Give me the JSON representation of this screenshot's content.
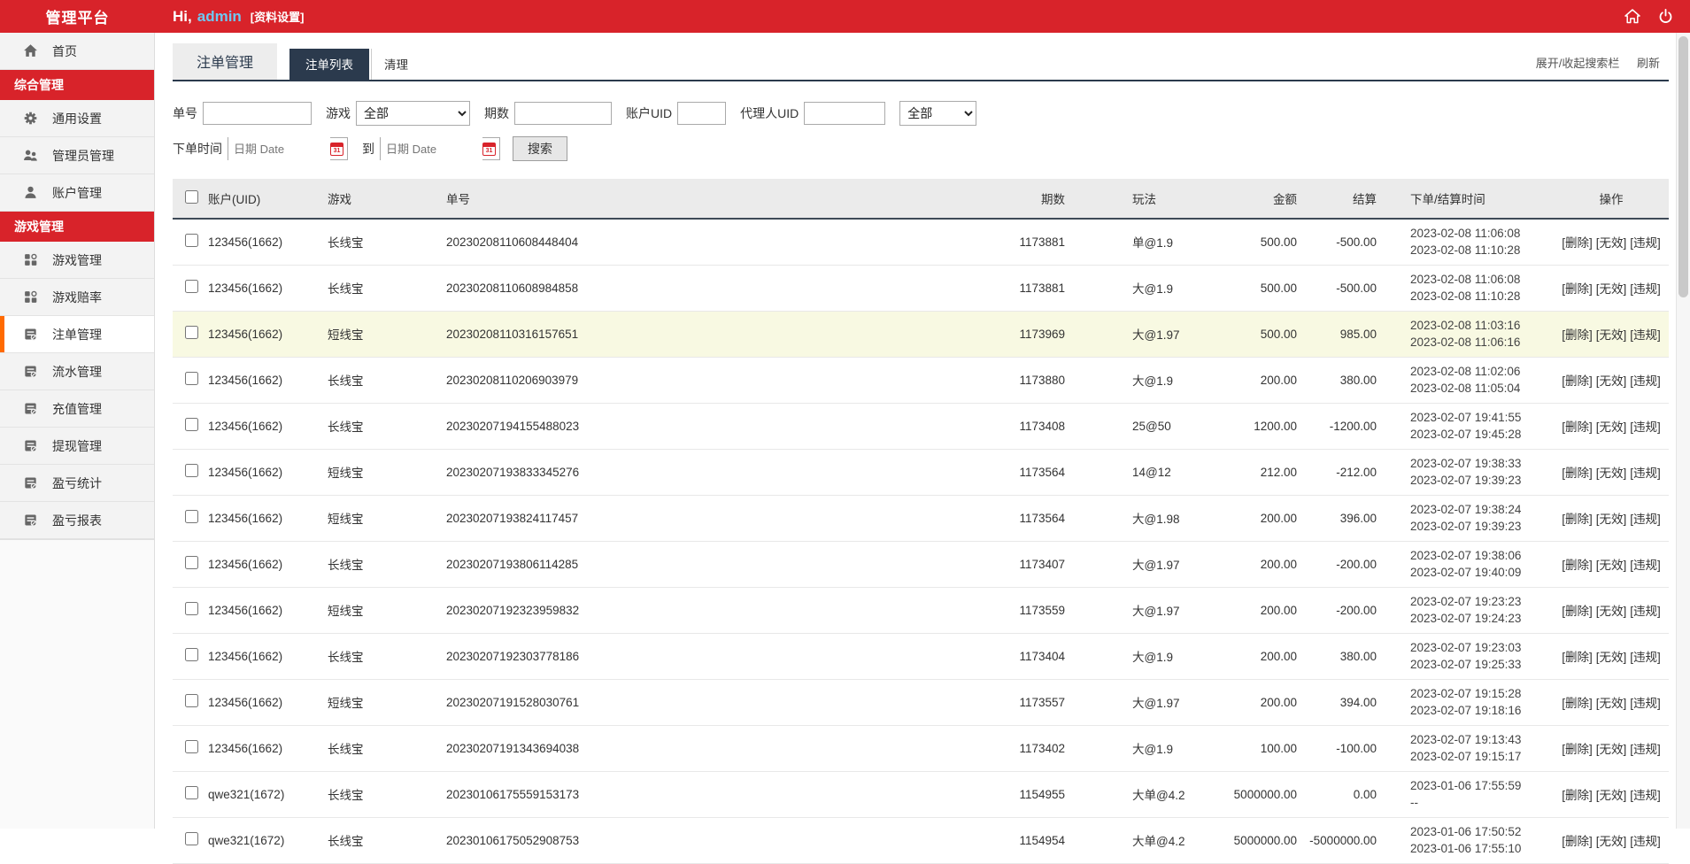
{
  "topbar": {
    "brand": "管理平台",
    "greeting_prefix": "Hi,",
    "username": "admin",
    "profile_link": "[资料设置]",
    "colors": {
      "bar": "#d8232a",
      "username": "#6fc7f2"
    }
  },
  "sidebar": {
    "items": [
      {
        "type": "item",
        "icon": "home",
        "label": "首页"
      },
      {
        "type": "section",
        "label": "综合管理"
      },
      {
        "type": "item",
        "icon": "gear",
        "label": "通用设置"
      },
      {
        "type": "item",
        "icon": "users",
        "label": "管理员管理"
      },
      {
        "type": "item",
        "icon": "user",
        "label": "账户管理"
      },
      {
        "type": "section",
        "label": "游戏管理"
      },
      {
        "type": "item",
        "icon": "grid",
        "label": "游戏管理"
      },
      {
        "type": "item",
        "icon": "grid",
        "label": "游戏赔率"
      },
      {
        "type": "item",
        "icon": "doc",
        "label": "注单管理",
        "active": true
      },
      {
        "type": "item",
        "icon": "doc",
        "label": "流水管理"
      },
      {
        "type": "item",
        "icon": "doc",
        "label": "充值管理"
      },
      {
        "type": "item",
        "icon": "doc",
        "label": "提现管理"
      },
      {
        "type": "item",
        "icon": "doc",
        "label": "盈亏统计"
      },
      {
        "type": "item",
        "icon": "doc",
        "label": "盈亏报表"
      }
    ],
    "active_accent": "#ff6a00"
  },
  "page": {
    "title": "注单管理",
    "tabs": [
      {
        "label": "注单列表",
        "active": true
      },
      {
        "label": "清理",
        "active": false
      }
    ],
    "toolbar": {
      "expand_label": "展开/收起搜索栏",
      "refresh_label": "刷新"
    },
    "accent_navy": "#2b3a4d"
  },
  "search": {
    "order_label": "单号",
    "game_label": "游戏",
    "game_value": "全部",
    "period_label": "期数",
    "account_uid_label": "账户UID",
    "agent_uid_label": "代理人UID",
    "status_value": "全部",
    "time_label": "下单时间",
    "to_label": "到",
    "date_placeholder": "日期 Date",
    "submit_label": "搜索"
  },
  "table": {
    "headers": [
      "账户(UID)",
      "游戏",
      "单号",
      "期数",
      "玩法",
      "金额",
      "结算",
      "下单/结算时间",
      "操作"
    ],
    "actions": [
      "[删除]",
      "[无效]",
      "[违规]"
    ],
    "highlight_color": "#f8f9e2",
    "rows": [
      {
        "account": "123456(1662)",
        "game": "长线宝",
        "order": "20230208110608448404",
        "period": "1173881",
        "play": "单@1.9",
        "amount": "500.00",
        "settle": "-500.00",
        "time1": "2023-02-08 11:06:08",
        "time2": "2023-02-08 11:10:28",
        "highlight": false
      },
      {
        "account": "123456(1662)",
        "game": "长线宝",
        "order": "20230208110608984858",
        "period": "1173881",
        "play": "大@1.9",
        "amount": "500.00",
        "settle": "-500.00",
        "time1": "2023-02-08 11:06:08",
        "time2": "2023-02-08 11:10:28",
        "highlight": false
      },
      {
        "account": "123456(1662)",
        "game": "短线宝",
        "order": "20230208110316157651",
        "period": "1173969",
        "play": "大@1.97",
        "amount": "500.00",
        "settle": "985.00",
        "time1": "2023-02-08 11:03:16",
        "time2": "2023-02-08 11:06:16",
        "highlight": true
      },
      {
        "account": "123456(1662)",
        "game": "长线宝",
        "order": "20230208110206903979",
        "period": "1173880",
        "play": "大@1.9",
        "amount": "200.00",
        "settle": "380.00",
        "time1": "2023-02-08 11:02:06",
        "time2": "2023-02-08 11:05:04",
        "highlight": false
      },
      {
        "account": "123456(1662)",
        "game": "长线宝",
        "order": "20230207194155488023",
        "period": "1173408",
        "play": "25@50",
        "amount": "1200.00",
        "settle": "-1200.00",
        "time1": "2023-02-07 19:41:55",
        "time2": "2023-02-07 19:45:28",
        "highlight": false
      },
      {
        "account": "123456(1662)",
        "game": "短线宝",
        "order": "20230207193833345276",
        "period": "1173564",
        "play": "14@12",
        "amount": "212.00",
        "settle": "-212.00",
        "time1": "2023-02-07 19:38:33",
        "time2": "2023-02-07 19:39:23",
        "highlight": false
      },
      {
        "account": "123456(1662)",
        "game": "短线宝",
        "order": "20230207193824117457",
        "period": "1173564",
        "play": "大@1.98",
        "amount": "200.00",
        "settle": "396.00",
        "time1": "2023-02-07 19:38:24",
        "time2": "2023-02-07 19:39:23",
        "highlight": false
      },
      {
        "account": "123456(1662)",
        "game": "长线宝",
        "order": "20230207193806114285",
        "period": "1173407",
        "play": "大@1.97",
        "amount": "200.00",
        "settle": "-200.00",
        "time1": "2023-02-07 19:38:06",
        "time2": "2023-02-07 19:40:09",
        "highlight": false
      },
      {
        "account": "123456(1662)",
        "game": "短线宝",
        "order": "20230207192323959832",
        "period": "1173559",
        "play": "大@1.97",
        "amount": "200.00",
        "settle": "-200.00",
        "time1": "2023-02-07 19:23:23",
        "time2": "2023-02-07 19:24:23",
        "highlight": false
      },
      {
        "account": "123456(1662)",
        "game": "长线宝",
        "order": "20230207192303778186",
        "period": "1173404",
        "play": "大@1.9",
        "amount": "200.00",
        "settle": "380.00",
        "time1": "2023-02-07 19:23:03",
        "time2": "2023-02-07 19:25:33",
        "highlight": false
      },
      {
        "account": "123456(1662)",
        "game": "短线宝",
        "order": "20230207191528030761",
        "period": "1173557",
        "play": "大@1.97",
        "amount": "200.00",
        "settle": "394.00",
        "time1": "2023-02-07 19:15:28",
        "time2": "2023-02-07 19:18:16",
        "highlight": false
      },
      {
        "account": "123456(1662)",
        "game": "长线宝",
        "order": "20230207191343694038",
        "period": "1173402",
        "play": "大@1.9",
        "amount": "100.00",
        "settle": "-100.00",
        "time1": "2023-02-07 19:13:43",
        "time2": "2023-02-07 19:15:17",
        "highlight": false
      },
      {
        "account": "qwe321(1672)",
        "game": "长线宝",
        "order": "20230106175559153173",
        "period": "1154955",
        "play": "大单@4.2",
        "amount": "5000000.00",
        "settle": "0.00",
        "time1": "2023-01-06 17:55:59",
        "time2": "--",
        "highlight": false
      },
      {
        "account": "qwe321(1672)",
        "game": "长线宝",
        "order": "20230106175052908753",
        "period": "1154954",
        "play": "大单@4.2",
        "amount": "5000000.00",
        "settle": "-5000000.00",
        "time1": "2023-01-06 17:50:52",
        "time2": "2023-01-06 17:55:10",
        "highlight": false
      }
    ]
  }
}
